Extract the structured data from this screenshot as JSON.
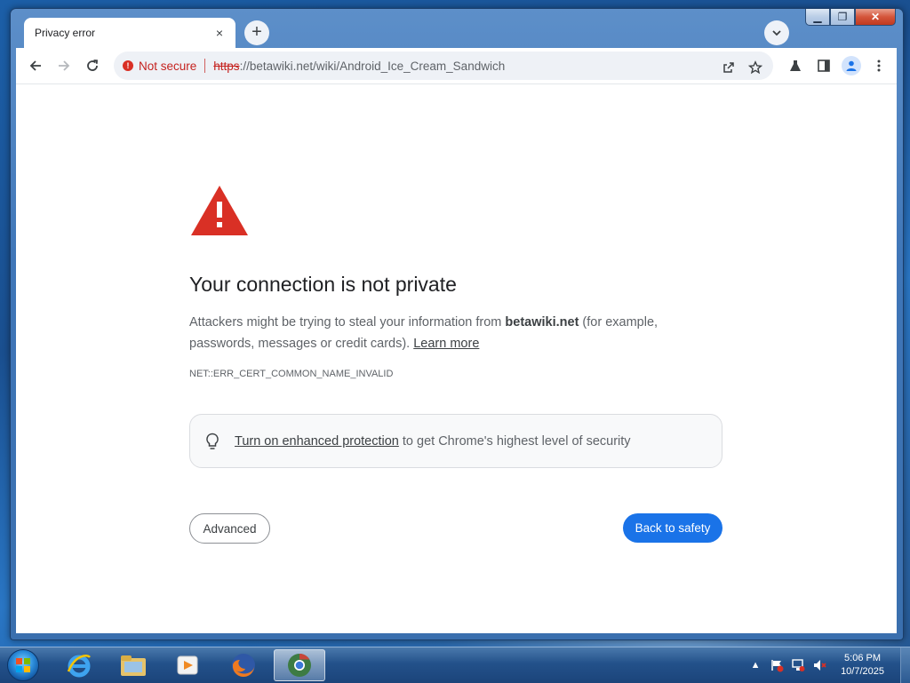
{
  "browser": {
    "tab_title": "Privacy error",
    "tab_close": "×",
    "new_tab": "+",
    "security_status": "Not secure",
    "url_scheme": "https",
    "url_rest": "://betawiki.net/wiki/Android_Ice_Cream_Sandwich"
  },
  "window_controls": {
    "minimize": "▁",
    "maximize": "❐",
    "close": "✕"
  },
  "error_page": {
    "headline": "Your connection is not private",
    "body_prefix": "Attackers might be trying to steal your information from ",
    "domain": "betawiki.net",
    "body_suffix": " (for example, passwords, messages or credit cards). ",
    "learn_more": "Learn more",
    "error_code": "NET::ERR_CERT_COMMON_NAME_INVALID",
    "enhanced_link": "Turn on enhanced protection",
    "enhanced_rest": " to get Chrome's highest level of security",
    "advanced_button": "Advanced",
    "back_button": "Back to safety"
  },
  "taskbar": {
    "time": "5:06 PM",
    "date": "10/7/2025",
    "pinned": [
      "internet-explorer",
      "file-explorer",
      "media-player",
      "firefox",
      "chrome"
    ]
  },
  "colors": {
    "warning_red": "#d93025",
    "primary_blue": "#1a73e8"
  }
}
